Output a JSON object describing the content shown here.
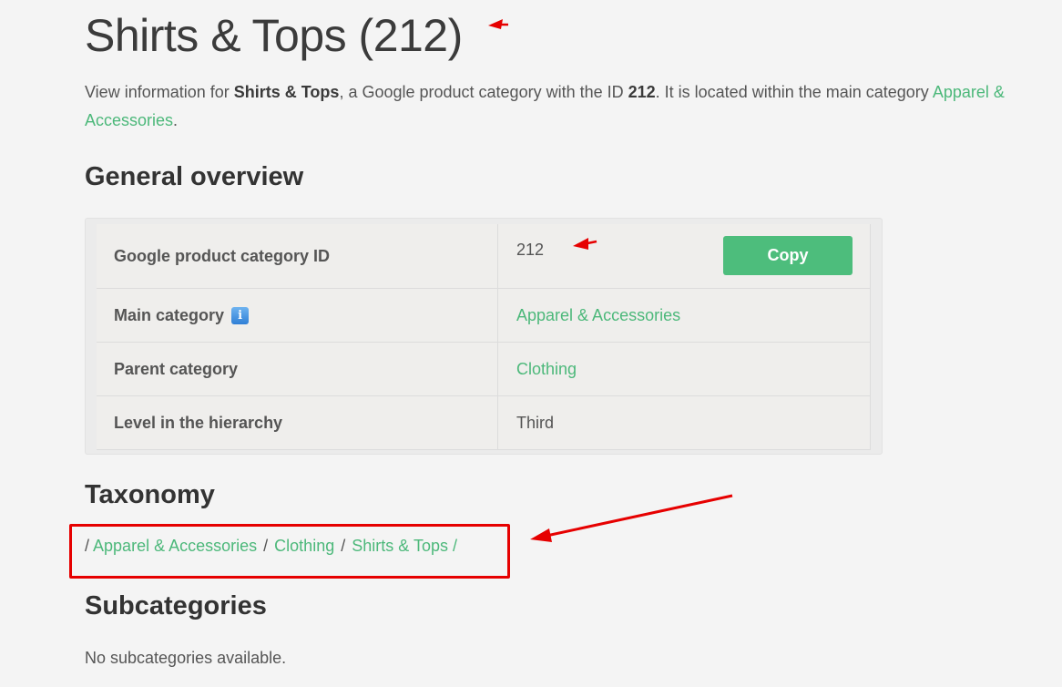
{
  "title": "Shirts & Tops (212)",
  "intro": {
    "prefix": "View information for ",
    "name": "Shirts & Tops",
    "middle": ", a Google product category with the ID ",
    "id": "212",
    "suffix": ". It is located within the main category ",
    "main_category_link": "Apparel & Accessories",
    "end": "."
  },
  "overview": {
    "heading": "General overview",
    "rows": [
      {
        "key": "Google product category ID",
        "value": "212"
      },
      {
        "key": "Main category",
        "value": "Apparel & Accessories"
      },
      {
        "key": "Parent category",
        "value": "Clothing"
      },
      {
        "key": "Level in the hierarchy",
        "value": "Third"
      }
    ],
    "copy_label": "Copy",
    "info_icon": "i"
  },
  "taxonomy": {
    "heading": "Taxonomy",
    "lead": "/",
    "items": [
      "Apparel & Accessories",
      "Clothing",
      "Shirts & Tops"
    ],
    "separator": "/"
  },
  "subcategories": {
    "heading": "Subcategories",
    "empty_text": "No subcategories available."
  },
  "colors": {
    "link": "#4cb87a",
    "button": "#4dbd7c",
    "annotation": "#e60000",
    "info_icon": "#2f7fd6"
  }
}
